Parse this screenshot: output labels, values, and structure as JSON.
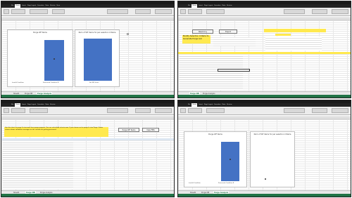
{
  "ribbon_tabs": [
    "File",
    "Home",
    "Insert",
    "Page Layout",
    "Formulas",
    "Data",
    "Review",
    "View",
    "Developer",
    "Add-ins",
    "Power Pivot",
    "Team",
    "Acrobat"
  ],
  "panes": [
    {
      "sheet_tabs": [
        "Sheet1",
        "Purge DB",
        "Purge Analysis"
      ],
      "active_tab": 2,
      "chart1": {
        "title": "Purge WF Items",
        "categories": [
          "Invalid Condition",
          "Processed Condition B",
          "Fail WF Items"
        ]
      },
      "chart2": {
        "title": "Num of WF items for per selection Criteria"
      }
    },
    {
      "buttons": {
        "reset": "Reset Any",
        "export": "Export"
      },
      "note": "Modify Selection Criteria to Generate Purge List",
      "sheet_tabs": [
        "Purge DB",
        "Purge Analysis"
      ],
      "active_tab": 0
    },
    {
      "banner": "Use this sheet to purge & view work item purge progress. You can select/add criteria rows. If you choose not to purge & view Purge, Status column shows validation messages on the records we getting processed.",
      "buttons": {
        "purge": "Purge WF Items",
        "view": "View FMS"
      },
      "sheet_tabs": [
        "Sheet1",
        "Purge DB",
        "Purge Analysis"
      ],
      "active_tab": 1
    },
    {
      "sheet_tabs": [
        "Sheet1",
        "Purge DB",
        "Purge Analysis"
      ],
      "active_tab": 2,
      "chart1": {
        "title": "Purge WF Items",
        "categories": [
          "Invalid Condition",
          "Processed Condition B"
        ]
      },
      "chart2": {
        "title": "Num of WF items for per selection Criteria"
      }
    }
  ],
  "colors": {
    "excel_green": "#217346",
    "bar_blue": "#4472c4",
    "highlight_yellow": "#ffe94f"
  }
}
